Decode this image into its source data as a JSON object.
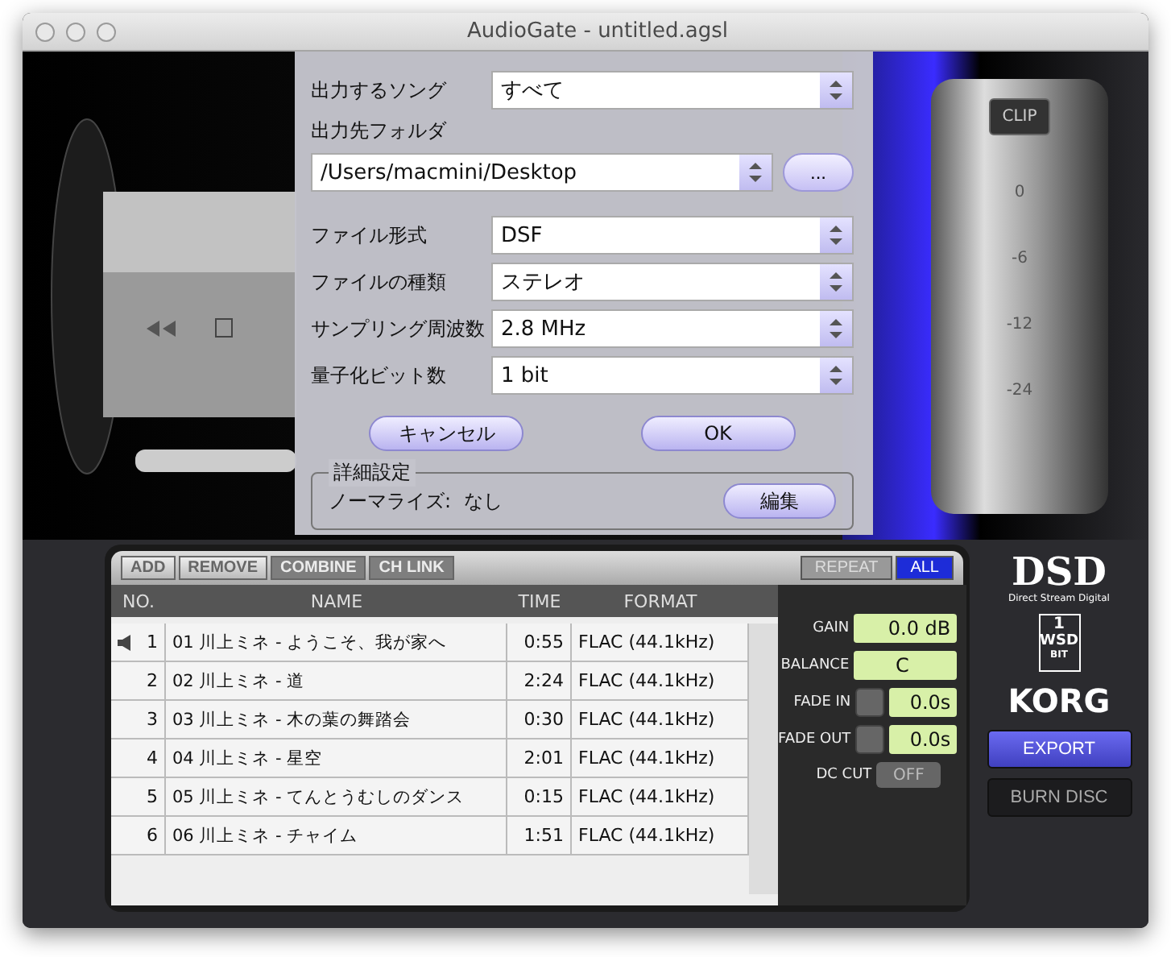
{
  "window": {
    "title": "AudioGate - untitled.agsl"
  },
  "meter": {
    "clip": "CLIP",
    "scale": [
      "0",
      "-6",
      "-12",
      "-24"
    ]
  },
  "dialog": {
    "fields": [
      {
        "kind": "select",
        "label": "出力するソング",
        "value": "すべて"
      },
      {
        "kind": "path",
        "label": "出力先フォルダ",
        "value": "/Users/macmini/Desktop",
        "browse": "..."
      },
      {
        "kind": "select",
        "label": "ファイル形式",
        "value": "DSF"
      },
      {
        "kind": "select",
        "label": "ファイルの種類",
        "value": "ステレオ"
      },
      {
        "kind": "select",
        "label": "サンプリング周波数",
        "value": "2.8 MHz"
      },
      {
        "kind": "select",
        "label": "量子化ビット数",
        "value": "1 bit"
      }
    ],
    "buttons": [
      "キャンセル",
      "OK"
    ],
    "advanced": {
      "title": "詳細設定",
      "normalize_label": "ノーマライズ:",
      "normalize_value": "なし",
      "edit_button": "編集"
    }
  },
  "toolbar": {
    "buttons": [
      {
        "label": "ADD",
        "disabled": false
      },
      {
        "label": "REMOVE",
        "disabled": false
      },
      {
        "label": "COMBINE",
        "disabled": true
      },
      {
        "label": "CH LINK",
        "disabled": true
      }
    ],
    "repeat_modes": [
      {
        "label": "REPEAT",
        "selected": false
      },
      {
        "label": "ALL",
        "selected": true
      }
    ]
  },
  "table": {
    "columns": [
      "NO.",
      "NAME",
      "TIME",
      "FORMAT"
    ],
    "rows": [
      {
        "no": "1",
        "name": "01 川上ミネ - ようこそ、我が家へ",
        "time": "0:55",
        "format": "FLAC (44.1kHz)",
        "playing": true
      },
      {
        "no": "2",
        "name": "02 川上ミネ - 道",
        "time": "2:24",
        "format": "FLAC (44.1kHz)",
        "playing": false
      },
      {
        "no": "3",
        "name": "03 川上ミネ - 木の葉の舞踏会",
        "time": "0:30",
        "format": "FLAC (44.1kHz)",
        "playing": false
      },
      {
        "no": "4",
        "name": "04 川上ミネ - 星空",
        "time": "2:01",
        "format": "FLAC (44.1kHz)",
        "playing": false
      },
      {
        "no": "5",
        "name": "05 川上ミネ - てんとうむしのダンス",
        "time": "0:15",
        "format": "FLAC (44.1kHz)",
        "playing": false
      },
      {
        "no": "6",
        "name": "06 川上ミネ - チャイム",
        "time": "1:51",
        "format": "FLAC (44.1kHz)",
        "playing": false
      }
    ]
  },
  "controls": [
    {
      "kind": "value",
      "label": "GAIN",
      "value": "0.0 dB"
    },
    {
      "kind": "value",
      "label": "BALANCE",
      "value": "C"
    },
    {
      "kind": "fade",
      "label": "FADE IN",
      "value": "0.0s"
    },
    {
      "kind": "fade",
      "label": "FADE OUT",
      "value": "0.0s"
    },
    {
      "kind": "switch",
      "label": "DC CUT",
      "value": "OFF",
      "on": false
    }
  ],
  "logos": {
    "dsd": "DSD",
    "dsd_sub": "Direct Stream Digital",
    "wsd_number": "1",
    "wsd": "WSD",
    "wsd_bit": "BIT",
    "brand": "KORG"
  },
  "side_buttons": [
    {
      "label": "EXPORT",
      "highlighted": true
    },
    {
      "label": "BURN DISC",
      "highlighted": false
    }
  ]
}
